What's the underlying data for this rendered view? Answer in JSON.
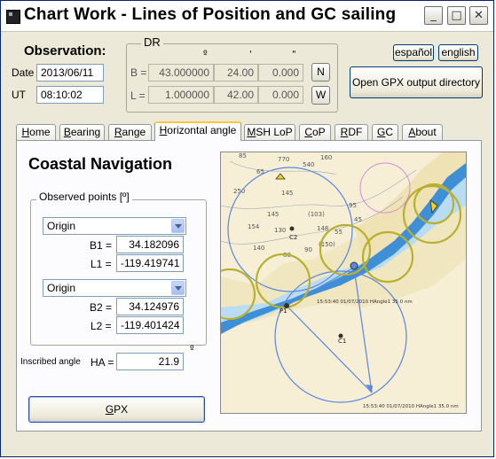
{
  "window": {
    "title": "Chart Work - Lines of Position and GC sailing",
    "controls": {
      "minimize": "_",
      "maximize": "□",
      "close": "✕"
    }
  },
  "observation": {
    "heading": "Observation:",
    "date_label": "Date",
    "date_value": "2013/06/11",
    "ut_label": "UT",
    "ut_value": "08:10:02"
  },
  "dr": {
    "legend": "DR",
    "units": [
      "º",
      "'",
      "\""
    ],
    "lat_label": "B =",
    "lat_deg": "43.000000",
    "lat_min": "24.00",
    "lat_sec": "0.000",
    "lat_hemi": "N",
    "lon_label": "L =",
    "lon_deg": "1.000000",
    "lon_min": "42.00",
    "lon_sec": "0.000",
    "lon_hemi": "W"
  },
  "language": {
    "spanish": "español",
    "english": "english"
  },
  "gpx_dir_button": "Open GPX output directory",
  "tabs": [
    {
      "label": "Home",
      "key": "H",
      "rest": "ome"
    },
    {
      "label": "Bearing",
      "key": "B",
      "rest": "earing"
    },
    {
      "label": "Range",
      "key": "R",
      "rest": "ange"
    },
    {
      "label": "Horizontal angle",
      "key": "H",
      "rest": "orizontal angle"
    },
    {
      "label": "MSH LoP",
      "key": "M",
      "rest": "SH LoP"
    },
    {
      "label": "CoP",
      "key": "C",
      "rest": "oP"
    },
    {
      "label": "RDF",
      "key": "R",
      "rest": "DF"
    },
    {
      "label": "GC",
      "key": "G",
      "rest": "C"
    },
    {
      "label": "About",
      "key": "A",
      "rest": "bout"
    }
  ],
  "active_tab": "Horizontal angle",
  "coastal": {
    "title": "Coastal Navigation",
    "group_legend": "Observed points  [º]",
    "point1_select": "Origin",
    "b1_label": "B1 =",
    "b1_value": "34.182096",
    "l1_label": "L1 =",
    "l1_value": "-119.419741",
    "point2_select": "Origin",
    "b2_label": "B2 =",
    "b2_value": "34.124976",
    "l2_label": "L2 =",
    "l2_value": "-119.401424",
    "inscribed_label": "Inscribed angle",
    "ha_label": "HA =",
    "ha_value": "21.9",
    "ha_unit": "º",
    "gpx_button": "GPX",
    "gpx_key": "G",
    "gpx_rest": "PX"
  },
  "map": {
    "depths": [
      "770",
      "540",
      "160",
      "250",
      "145",
      "154",
      "130",
      "(103)",
      "148",
      "95",
      "(150)",
      "85",
      "65",
      "90",
      "45",
      "140",
      "80",
      "55",
      "145"
    ],
    "labels": [
      "C2",
      "C1",
      "P1"
    ],
    "note1": "15:53:40 01/07/2010 HAngle1 35.0 nm",
    "note2": "15:53:40 01/07/2010 HAngle1 35.0 nm"
  },
  "colors": {
    "title_bg": "#ffffff",
    "tab_highlight": "#ffc83c",
    "window_bg": "#ece9d8",
    "sea_blue": "#3f8fd6",
    "circle_blue": "#5a86e0",
    "circle_yellow": "#b8b030"
  }
}
